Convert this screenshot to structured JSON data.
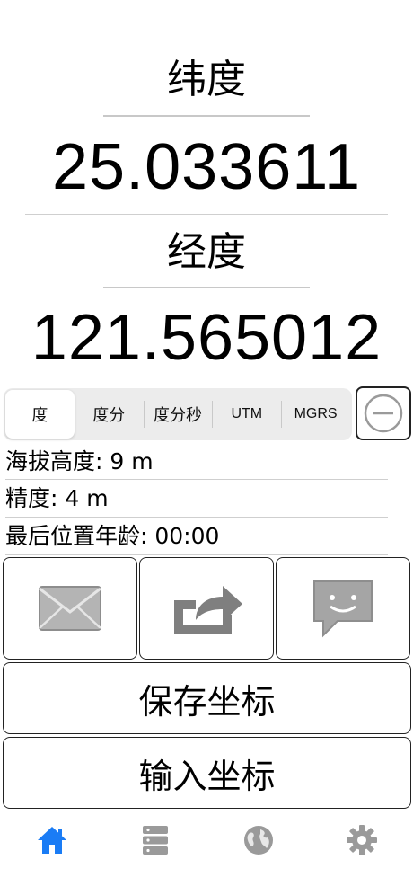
{
  "latitude": {
    "label": "纬度",
    "value": "25.033611"
  },
  "longitude": {
    "label": "经度",
    "value": "121.565012"
  },
  "format_segments": [
    {
      "label": "度",
      "selected": true
    },
    {
      "label": "度分",
      "selected": false
    },
    {
      "label": "度分秒",
      "selected": false
    },
    {
      "label": "UTM",
      "selected": false
    },
    {
      "label": "MGRS",
      "selected": false
    }
  ],
  "info": {
    "altitude": "海拔高度: 9 m",
    "accuracy": "精度: 4 m",
    "last_fix_age": "最后位置年龄: 00:00"
  },
  "share_icons": [
    "mail-icon",
    "share-icon",
    "message-icon"
  ],
  "actions": {
    "save": "保存坐标",
    "input": "输入坐标"
  },
  "tabs": [
    {
      "icon": "home-icon",
      "active": true
    },
    {
      "icon": "list-icon",
      "active": false
    },
    {
      "icon": "globe-icon",
      "active": false
    },
    {
      "icon": "gear-icon",
      "active": false
    }
  ],
  "colors": {
    "accent": "#1a7cf5",
    "inactive_icon": "#9a9a9a",
    "share_icon": "#8a8a8a"
  }
}
